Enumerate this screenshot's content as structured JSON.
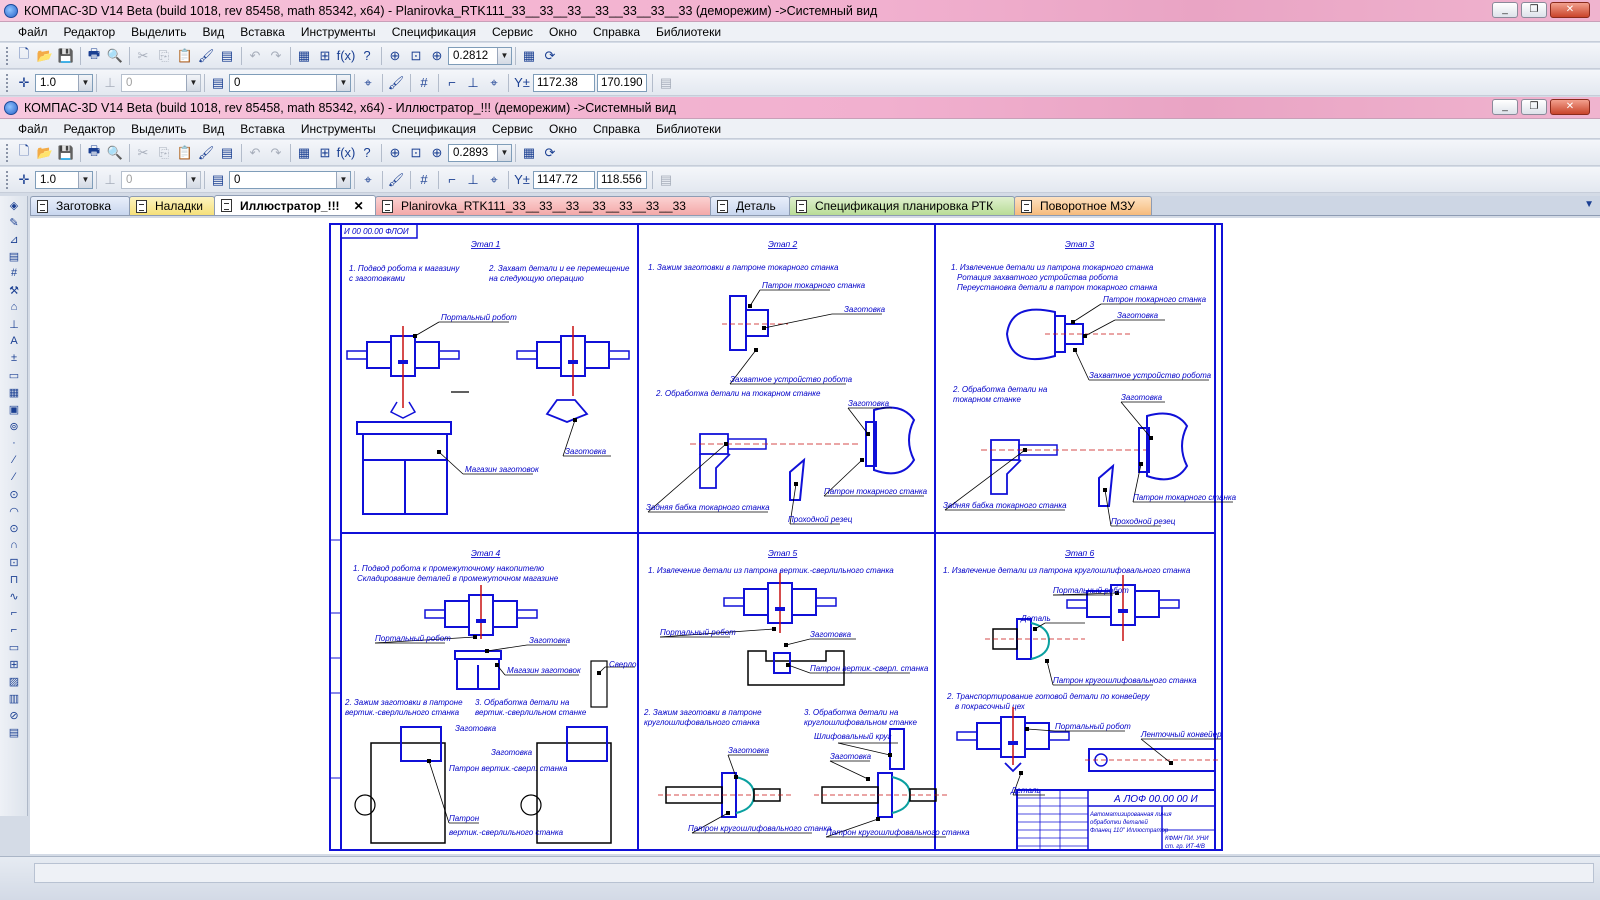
{
  "window_outer": {
    "title": "КОМПАС-3D V14 Beta (build 1018, rev 85458, math 85342, x64) - Planirovka_RTK111_33__33__33__33__33__33__33 (деморежим) ->Системный вид",
    "controls": {
      "minimize": "_",
      "restore": "❐",
      "close": "✕"
    }
  },
  "window_inner": {
    "title": "КОМПАС-3D V14 Beta (build 1018, rev 85458, math 85342, x64) - Иллюстратор_!!! (деморежим) ->Системный вид",
    "controls": {
      "minimize": "_",
      "restore": "❐",
      "close": "✕"
    }
  },
  "menu": [
    "Файл",
    "Редактор",
    "Выделить",
    "Вид",
    "Вставка",
    "Инструменты",
    "Спецификация",
    "Сервис",
    "Окно",
    "Справка",
    "Библиотеки"
  ],
  "toolbar_outer": {
    "zoom": "0.2812",
    "scale": "1.0",
    "angle": "0",
    "layer": "0",
    "x": "1172.38",
    "y": "170.190"
  },
  "toolbar_inner": {
    "zoom": "0.2893",
    "scale": "1.0",
    "angle": "0",
    "layer": "0",
    "x": "1147.72",
    "y": "118.556"
  },
  "icons": {
    "new": "new-document-icon",
    "open": "open-folder-icon",
    "save": "save-icon",
    "print": "print-icon",
    "preview": "print-preview-icon",
    "cut": "cut-icon",
    "copy": "copy-icon",
    "paste": "paste-icon",
    "format": "format-brush-icon",
    "properties": "properties-icon",
    "undo": "undo-icon",
    "redo": "redo-icon",
    "tree": "model-tree-icon",
    "variables": "variables-icon",
    "formula": "function-icon",
    "help": "context-help-icon",
    "zoom_fit": "zoom-fit-icon",
    "zoom_window": "zoom-window-icon",
    "zoom": "zoom-icon",
    "refresh": "refresh-icon",
    "cursor": "cursor-icon"
  },
  "icon_glyphs": {
    "new": "🗋",
    "open": "📂",
    "save": "💾",
    "print": "🖶",
    "preview": "🔍",
    "cut": "✂",
    "copy": "⎘",
    "paste": "📋",
    "format": "🖌",
    "properties": "▤",
    "undo": "↶",
    "redo": "↷",
    "tree": "▦",
    "variables": "⊞",
    "formula": "f(x)",
    "help": "?",
    "zoom_fit": "⊕",
    "zoom_window": "⊡",
    "zoom": "⊕",
    "refresh": "⟳",
    "cursor": "✛",
    "snap": "⌖",
    "grid": "#",
    "ortho": "⊥",
    "local_cs": "⌐",
    "coords": "Y±"
  },
  "tabs": [
    {
      "label": "Заготовка",
      "style": "tab-blue",
      "active": false
    },
    {
      "label": "Наладки",
      "style": "tab-yellow",
      "active": false
    },
    {
      "label": "Иллюстратор_!!!",
      "style": "tab-active",
      "active": true,
      "close": "✕"
    },
    {
      "label": "Planirovka_RTK111_33__33__33__33__33__33__33",
      "style": "tab-pink",
      "active": false
    },
    {
      "label": "Деталь",
      "style": "tab-blue",
      "active": false
    },
    {
      "label": "Спецификация планировка РТК",
      "style": "tab-green",
      "active": false
    },
    {
      "label": "Поворотное МЗУ",
      "style": "tab-orange",
      "active": false
    }
  ],
  "drawing": {
    "stamp": "И 00 00.00 ФЛОИ",
    "title_block": {
      "designation": "А ЛОФ 00.00 00 И",
      "name_lines": [
        "Автоматизированная линия",
        "обработки деталей",
        "Фланец 110\" Иллюстратор"
      ],
      "org": "КФМН  ПИ. УНИ",
      "group": "ст. гр. ИТ-4/В"
    },
    "stages": [
      {
        "title": "Этап 1",
        "texts": [
          "1. Подвод робота к магазину",
          "с заготовками",
          "2. Захват детали и ее перемещение",
          "на следующую операцию"
        ],
        "labels": [
          "Портальный робот",
          "Магазин заготовок",
          "Заготовка"
        ]
      },
      {
        "title": "Этап 2",
        "texts": [
          "1. Зажим заготовки в патроне токарного станка",
          "2. Обработка детали на токарном станке"
        ],
        "labels": [
          "Патрон токарного станка",
          "Заготовка",
          "Захватное устройство робота",
          "Заготовка",
          "Задняя бабка токарного станка",
          "Патрон токарного станка",
          "Проходной резец"
        ]
      },
      {
        "title": "Этап 3",
        "texts": [
          "1. Извлечение детали из патрона токарного станка",
          "Ротация захватного устройства робота",
          "Переустановка детали в патрон токарного станка",
          "2. Обработка детали на",
          "токарном станке"
        ],
        "labels": [
          "Патрон токарного станка",
          "Заготовка",
          "Захватное устройство робота",
          "Заготовка",
          "Задняя бабка токарного станка",
          "Патрон токарного станка",
          "Проходной резец"
        ]
      },
      {
        "title": "Этап 4",
        "texts": [
          "1. Подвод робота к промежуточному накопителю",
          "Складирование деталей в промежуточном магазине",
          "2. Зажим заготовки в патроне",
          "вертик.-сверлильного станка",
          "3. Обработка детали на",
          "вертик.-сверлильном станке"
        ],
        "labels": [
          "Портальный робот",
          "Заготовка",
          "Магазин заготовок",
          "Сверло",
          "Заготовка",
          "Заготовка",
          "Патрон вертик.-сверл. станка",
          "Патрон",
          "вертик.-сверлильного станка"
        ]
      },
      {
        "title": "Этап 5",
        "texts": [
          "1. Извлечение детали из патрона вертик.-сверлильного станка",
          "2. Зажим заготовки в патроне",
          "круглошлифовального станка",
          "3. Обработка детали на",
          "круглошлифовальном станке"
        ],
        "labels": [
          "Портальный робот",
          "Заготовка",
          "Патрон вертик.-сверл. станка",
          "Заготовка",
          "Шлифовальный круг",
          "Заготовка",
          "Патрон кругошлифовального станка",
          "Патрон кругошлифовального станка"
        ]
      },
      {
        "title": "Этап 6",
        "texts": [
          "1. Извлечение детали из патрона круглошлифовального станка",
          "2. Транспортирование готовой детали по конвейеру",
          "в покрасочный цех"
        ],
        "labels": [
          "Портальный робот",
          "Деталь",
          "Патрон кругошлифовального станка",
          "Портальный робот",
          "Ленточный конвейер",
          "Деталь"
        ]
      }
    ]
  }
}
